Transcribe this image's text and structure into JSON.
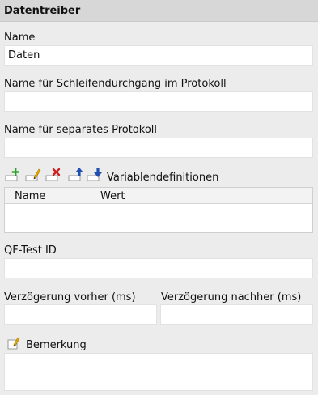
{
  "header": {
    "title": "Datentreiber"
  },
  "form": {
    "name_label": "Name",
    "name_value": "Daten",
    "loop_name_label": "Name für Schleifendurchgang im Protokoll",
    "loop_name_value": "",
    "separate_log_label": "Name für separates Protokoll",
    "separate_log_value": "",
    "variables_label": "Variablendefinitionen",
    "qftest_id_label": "QF-Test ID",
    "qftest_id_value": "",
    "delay_before_label": "Verzögerung vorher (ms)",
    "delay_before_value": "",
    "delay_after_label": "Verzögerung nachher (ms)",
    "delay_after_value": "",
    "comment_label": "Bemerkung",
    "comment_value": ""
  },
  "variables_table": {
    "columns": [
      "Name",
      "Wert"
    ],
    "rows": []
  },
  "toolbar": {
    "icons": [
      "add-icon",
      "edit-icon",
      "delete-icon",
      "move-up-icon",
      "move-down-icon"
    ],
    "colors": {
      "add": "#2aa02a",
      "edit": "#e6a800",
      "delete": "#cc2222",
      "move": "#1f4fb0"
    }
  }
}
